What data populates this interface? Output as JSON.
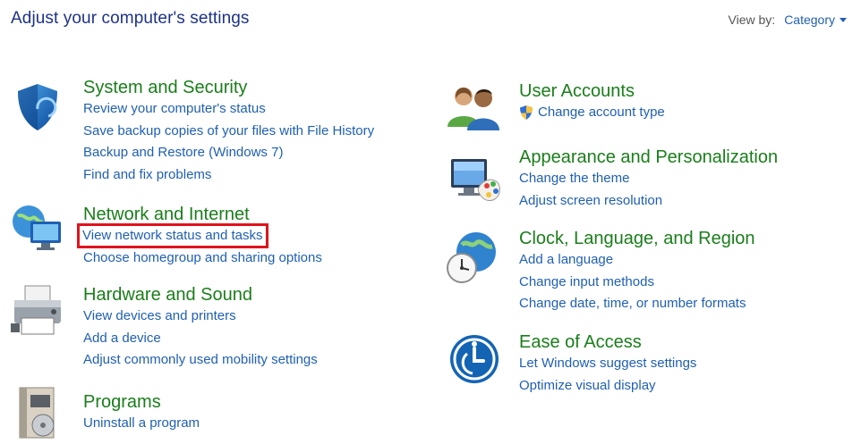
{
  "header": {
    "title": "Adjust your computer's settings",
    "view_by_label": "View by:",
    "view_by_value": "Category"
  },
  "left_column": [
    {
      "title": "System and Security",
      "icon": "shield-icon",
      "links": [
        "Review your computer's status",
        "Save backup copies of your files with File History",
        "Backup and Restore (Windows 7)",
        "Find and fix problems"
      ]
    },
    {
      "title": "Network and Internet",
      "icon": "network-globe-icon",
      "links": [
        "View network status and tasks",
        "Choose homegroup and sharing options"
      ],
      "highlighted_link": "View network status and tasks",
      "highlight_color": "#e0141b"
    },
    {
      "title": "Hardware and Sound",
      "icon": "printer-icon",
      "links": [
        "View devices and printers",
        "Add a device",
        "Adjust commonly used mobility settings"
      ]
    },
    {
      "title": "Programs",
      "icon": "programs-disc-icon",
      "links": [
        "Uninstall a program"
      ]
    }
  ],
  "right_column": [
    {
      "title": "User Accounts",
      "icon": "users-icon",
      "links": [
        "Change account type"
      ],
      "link_icon": "uac-shield-icon"
    },
    {
      "title": "Appearance and Personalization",
      "icon": "monitor-palette-icon",
      "links": [
        "Change the theme",
        "Adjust screen resolution"
      ]
    },
    {
      "title": "Clock, Language, and Region",
      "icon": "clock-globe-icon",
      "links": [
        "Add a language",
        "Change input methods",
        "Change date, time, or number formats"
      ]
    },
    {
      "title": "Ease of Access",
      "icon": "ease-of-access-icon",
      "links": [
        "Let Windows suggest settings",
        "Optimize visual display"
      ]
    }
  ],
  "colors": {
    "title_blue": "#1e3287",
    "category_green": "#1a7e1a",
    "link_blue": "#1f5fb4",
    "highlight_red": "#e0141b"
  }
}
